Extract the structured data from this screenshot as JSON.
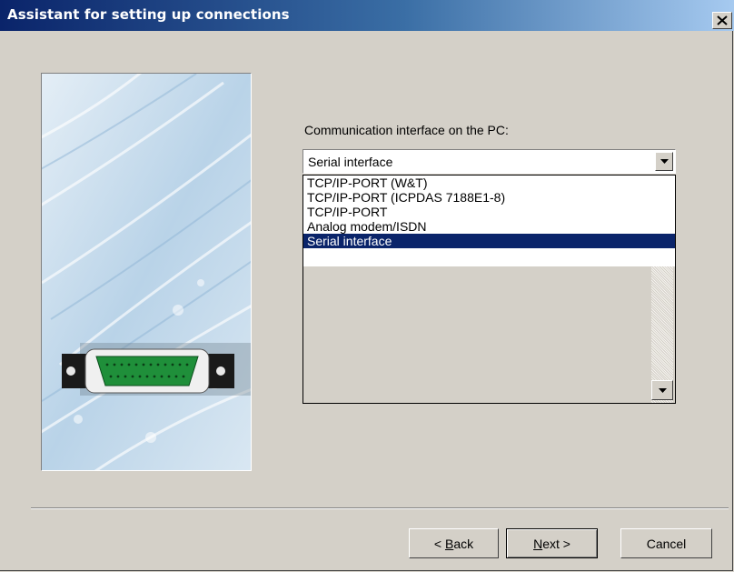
{
  "window": {
    "title": "Assistant for setting up connections",
    "close_glyph": "✕"
  },
  "comm": {
    "label": "Communication interface on the PC:",
    "selected": "Serial interface",
    "options": [
      "TCP/IP-PORT (W&T)",
      "TCP/IP-PORT (ICPDAS 7188E1-8)",
      "TCP/IP-PORT",
      "Analog modem/ISDN",
      "Serial interface"
    ],
    "selected_index": 4
  },
  "buttons": {
    "back": {
      "pre": "< ",
      "accel": "B",
      "rest": "ack"
    },
    "next": {
      "accel": "N",
      "rest": "ext >"
    },
    "cancel": "Cancel"
  },
  "colors": {
    "selection": "#0a246a",
    "connector_green": "#1f8f3a"
  }
}
